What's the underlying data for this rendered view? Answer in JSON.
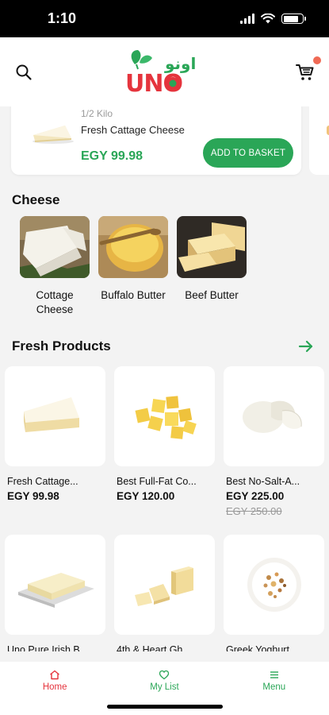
{
  "status_bar": {
    "time": "1:10"
  },
  "header": {
    "logo_wordmark": "UNO",
    "logo_arabic": "اونو",
    "icons": {
      "search": "search-icon",
      "cart": "cart-icon"
    },
    "colors": {
      "logo_red": "#e5343d",
      "logo_green": "#2aa657",
      "cart_badge": "#f06a55"
    }
  },
  "featured": {
    "weight": "1/2 Kilo",
    "name": "Fresh Cattage Cheese",
    "price": "EGY 99.98",
    "button_label": "ADD TO BASKET"
  },
  "cheese_section": {
    "title": "Cheese",
    "categories": [
      {
        "label": "Cottage Cheese"
      },
      {
        "label": "Buffalo Butter"
      },
      {
        "label": "Beef Butter"
      }
    ]
  },
  "fresh_section": {
    "title": "Fresh Products",
    "arrow_icon": "arrow-right-icon",
    "products": [
      {
        "name": "Fresh Cattage...",
        "price": "EGY 99.98",
        "old_price": ""
      },
      {
        "name": "Best Full-Fat Co...",
        "price": "EGY 120.00",
        "old_price": ""
      },
      {
        "name": "Best No-Salt-A...",
        "price": "EGY 225.00",
        "old_price": "EGY 250.00"
      },
      {
        "name": "Uno Pure Irish B...",
        "price": "",
        "old_price": ""
      },
      {
        "name": "4th & Heart Gh...",
        "price": "",
        "old_price": ""
      },
      {
        "name": "Greek Yoghurt...",
        "price": "",
        "old_price": ""
      }
    ]
  },
  "bottom_nav": {
    "items": [
      {
        "label": "Home",
        "icon": "home-icon",
        "active": true
      },
      {
        "label": "My List",
        "icon": "heart-icon",
        "active": false
      },
      {
        "label": "Menu",
        "icon": "menu-icon",
        "active": false
      }
    ]
  },
  "colors": {
    "accent_green": "#2aa657",
    "active_red": "#e5343d",
    "background": "#f3f3f3"
  }
}
